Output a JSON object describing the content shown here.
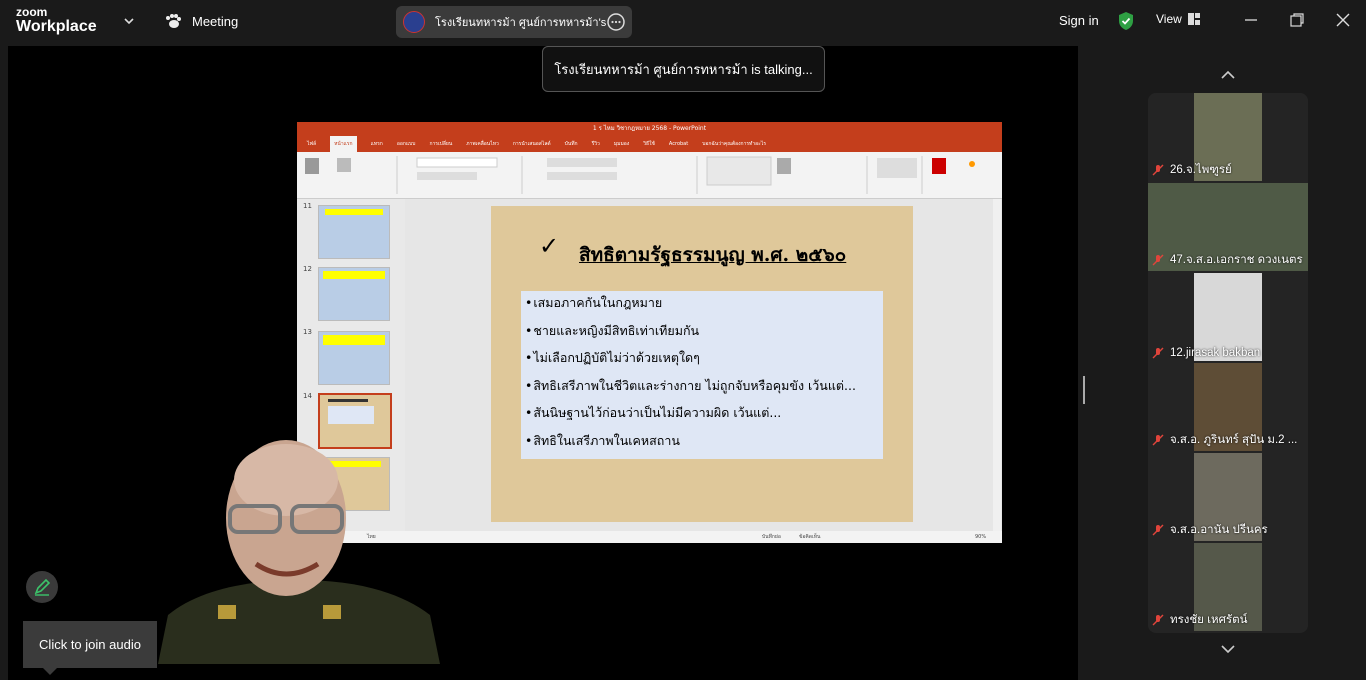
{
  "app": {
    "brand_small": "zoom",
    "brand_large": "Workplace"
  },
  "meeting": {
    "label": "Meeting"
  },
  "header": {
    "meeting_name": "โรงเรียนทหารม้า ศูนย์การทหารม้า's sc",
    "sign_in": "Sign in",
    "view": "View"
  },
  "talking": "โรงเรียนทหารม้า ศูนย์การทหารม้า is talking...",
  "ppt": {
    "title_bar": "1 ร ไหม วิชากฎหมาย 2568 - PowerPoint",
    "tabs": [
      "ไฟล์",
      "หน้าแรก",
      "แทรก",
      "ออกแบบ",
      "การเปลี่ยน",
      "ภาพเคลื่อนไหว",
      "การนำเสนอสไลด์",
      "บันทึก",
      "รีวิว",
      "มุมมอง",
      "วิธีใช้",
      "Acrobat",
      "บอกฉันว่าคุณต้องการทำอะไร"
    ],
    "slide_numbers": [
      "11",
      "12",
      "13",
      "14"
    ],
    "slide_title": "สิทธิตามรัฐธรรมนูญ พ.ศ. ๒๕๖๐",
    "bullets": [
      "เสมอภาคกันในกฎหมาย",
      "ชายและหญิงมีสิทธิเท่าเทียมกัน",
      "ไม่เลือกปฏิบัติไม่ว่าด้วยเหตุใดๆ",
      "สิทธิเสรีภาพในชีวิตและร่างกาย ไม่ถูกจับหรือคุมขัง เว้นแต่...",
      "สันนิษฐานไว้ก่อนว่าเป็นไม่มีความผิด เว้นแต่...",
      "สิทธิในเสรีภาพในเคหสถาน"
    ],
    "status_left": "ไทย",
    "status_notes": "บันทึกย่อ",
    "status_comments": "ข้อคิดเห็น",
    "zoom": "90%"
  },
  "tooltip": "Click to join audio",
  "participants": [
    {
      "name": "26.จ.ไพฑูรย์"
    },
    {
      "name": "47.จ.ส.อ.เอกราช  ดวงเนตร"
    },
    {
      "name": "12.jirasak bakban"
    },
    {
      "name": "จ.ส.อ. ภูรินทร์ สุปัน ม.2 ..."
    },
    {
      "name": "จ.ส.อ.อานัน ปรีนคร"
    },
    {
      "name": "ทรงชัย   เหศรัตน์"
    }
  ],
  "colors": {
    "accent_green": "#2ea043",
    "ppt_red": "#c43e1c",
    "muted_red": "#e0443b"
  }
}
